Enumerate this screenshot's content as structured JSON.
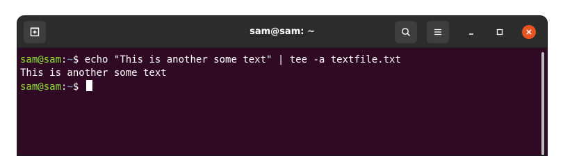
{
  "window": {
    "title": "sam@sam: ~"
  },
  "terminal": {
    "lines": [
      {
        "user_host": "sam@sam",
        "sep": ":",
        "path": "~",
        "prompt": "$ ",
        "command": "echo \"This is another some text\" | tee -a textfile.txt"
      },
      {
        "output": "This is another some text"
      },
      {
        "user_host": "sam@sam",
        "sep": ":",
        "path": "~",
        "prompt": "$ ",
        "command": ""
      }
    ]
  },
  "icons": {
    "new_tab": "new-tab-icon",
    "search": "search-icon",
    "menu": "hamburger-menu-icon",
    "minimize": "minimize-icon",
    "maximize": "maximize-icon",
    "close": "close-icon"
  },
  "colors": {
    "terminal_bg": "#300a24",
    "titlebar_bg": "#2c2c2c",
    "prompt_user": "#8ae234",
    "prompt_path": "#729fcf",
    "close_button": "#e95420"
  }
}
